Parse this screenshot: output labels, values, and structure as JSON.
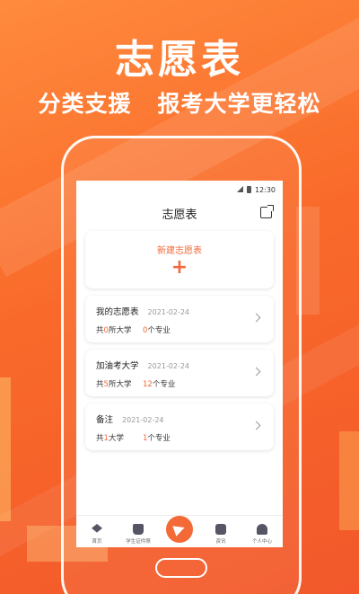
{
  "hero": {
    "title": "志愿表",
    "subtitle": "分类支援   报考大学更轻松"
  },
  "status_bar": {
    "time": "12:30"
  },
  "nav": {
    "title": "志愿表",
    "share_icon": "share-icon"
  },
  "new_card": {
    "label": "新建志愿表",
    "icon": "+"
  },
  "lists": [
    {
      "name": "我的志愿表",
      "date": "2021-02-24",
      "uni_prefix": "共",
      "uni_count": "0",
      "uni_suffix": "所大学",
      "major_count": "0",
      "major_suffix": "个专业"
    },
    {
      "name": "加油考大学",
      "date": "2021-02-24",
      "uni_prefix": "共",
      "uni_count": "5",
      "uni_suffix": "所大学",
      "major_count": "12",
      "major_suffix": "个专业"
    },
    {
      "name": "备注",
      "date": "2021-02-24",
      "uni_prefix": "共",
      "uni_count": "1",
      "uni_suffix": "大学",
      "major_count": "1",
      "major_suffix": "个专业"
    }
  ],
  "tabbar": {
    "items": [
      {
        "label": "首页",
        "icon": "graduation-cap-icon"
      },
      {
        "label": "学生证件照",
        "icon": "id-badge-icon"
      },
      {
        "label": "",
        "icon": "paper-plane-icon"
      },
      {
        "label": "资讯",
        "icon": "chat-icon"
      },
      {
        "label": "个人中心",
        "icon": "user-icon"
      }
    ]
  },
  "colors": {
    "accent": "#f26a3a",
    "background": "#f96a2a"
  }
}
